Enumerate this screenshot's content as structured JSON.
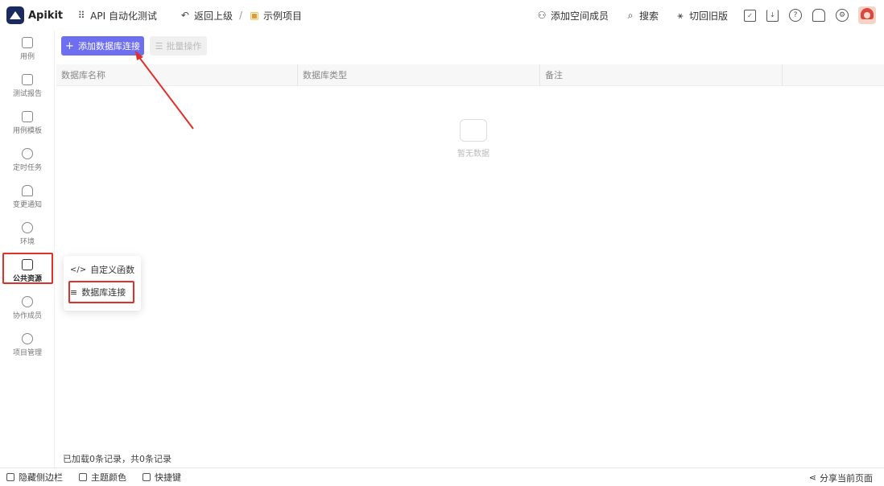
{
  "topbar": {
    "brand": "Apikit",
    "workspace": "API 自动化测试",
    "back_label": "返回上级",
    "separator": "/",
    "project": "示例项目",
    "add_member": "添加空间成员",
    "search": "搜索",
    "old_version": "切回旧版"
  },
  "sidebar": {
    "items": [
      {
        "label": "用例",
        "icon": "test-case-icon"
      },
      {
        "label": "测试报告",
        "icon": "report-icon"
      },
      {
        "label": "用例模板",
        "icon": "template-icon"
      },
      {
        "label": "定时任务",
        "icon": "timer-icon"
      },
      {
        "label": "变更通知",
        "icon": "bell-icon"
      },
      {
        "label": "环境",
        "icon": "cube-icon"
      },
      {
        "label": "公共资源",
        "icon": "puzzle-icon",
        "active": true
      },
      {
        "label": "协作成员",
        "icon": "members-icon"
      },
      {
        "label": "项目管理",
        "icon": "gear-icon"
      }
    ]
  },
  "main": {
    "add_button": "添加数据库连接",
    "batch_button": "批量操作",
    "columns": [
      "数据库名称",
      "数据库类型",
      "备注"
    ],
    "empty_text": "暂无数据",
    "status": "已加载0条记录，共0条记录"
  },
  "popup": {
    "items": [
      "自定义函数",
      "数据库连接"
    ]
  },
  "bottombar": {
    "hide_sidebar": "隐藏侧边栏",
    "theme": "主题颜色",
    "shortcuts": "快捷键",
    "share": "分享当前页面"
  },
  "colors": {
    "accent": "#6e6ef0",
    "highlight": "#e0302a"
  }
}
